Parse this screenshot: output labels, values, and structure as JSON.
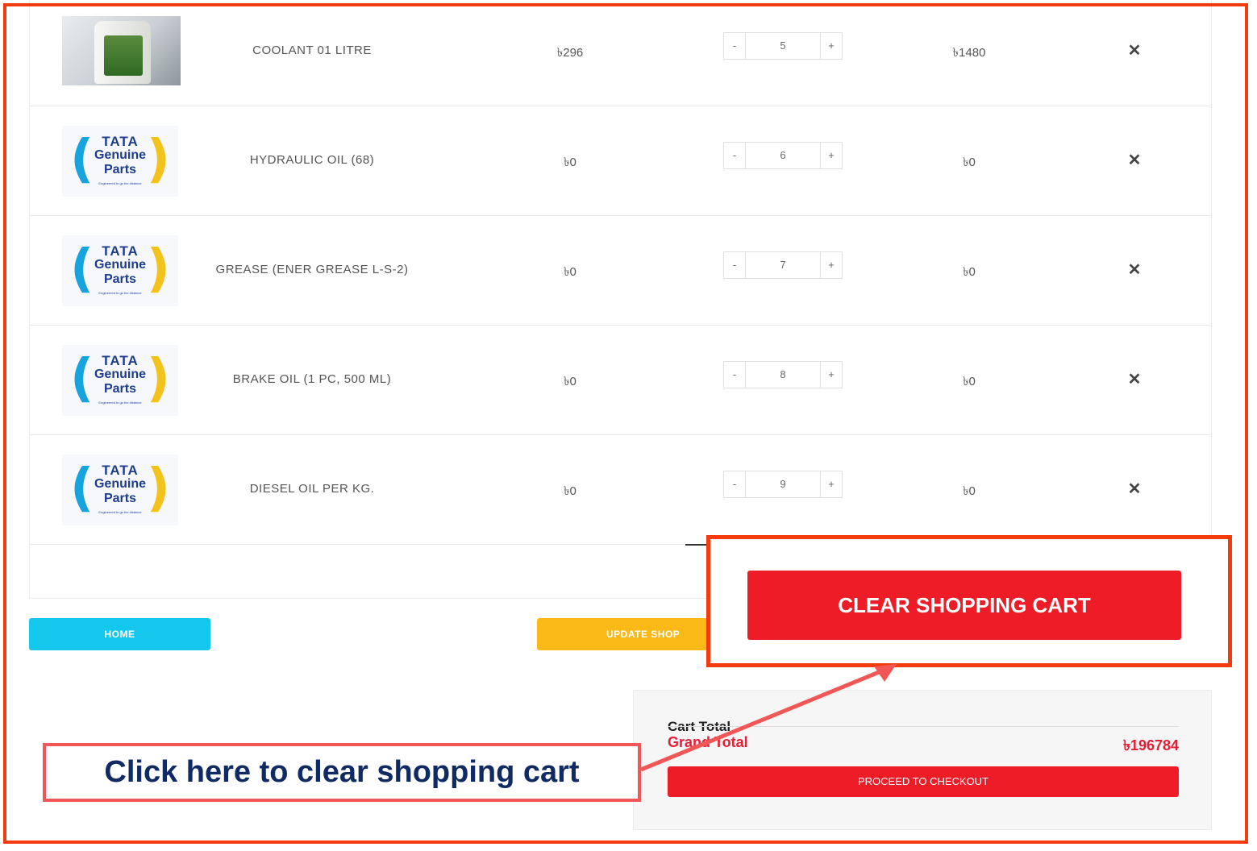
{
  "cart": {
    "items": [
      {
        "name": "COOLANT 01 LITRE",
        "price": "৳296",
        "qty": "5",
        "subtotal": "৳1480",
        "minus": "-",
        "plus": "+",
        "remove": "✕"
      },
      {
        "name": "HYDRAULIC OIL (68)",
        "price": "৳0",
        "qty": "6",
        "subtotal": "৳0",
        "minus": "-",
        "plus": "+",
        "remove": "✕"
      },
      {
        "name": "GREASE (ENER GREASE L-S-2)",
        "price": "৳0",
        "qty": "7",
        "subtotal": "৳0",
        "minus": "-",
        "plus": "+",
        "remove": "✕"
      },
      {
        "name": "BRAKE OIL (1 PC, 500 ML)",
        "price": "৳0",
        "qty": "8",
        "subtotal": "৳0",
        "minus": "-",
        "plus": "+",
        "remove": "✕"
      },
      {
        "name": "DIESEL OIL PER KG.",
        "price": "৳0",
        "qty": "9",
        "subtotal": "৳0",
        "minus": "-",
        "plus": "+",
        "remove": "✕"
      }
    ],
    "logo": {
      "line1": "TATA",
      "line2": "Genuine",
      "line3": "Parts",
      "tagline": "Engineered to go the distance"
    }
  },
  "actions": {
    "home": "HOME",
    "update": "UPDATE SHOP",
    "clear": "CLEAR SHOPPING CART"
  },
  "totals": {
    "cart_total": "Cart Total",
    "grand_total_label": "Grand Total",
    "grand_total_value": "৳196784",
    "checkout": "PROCEED TO CHECKOUT"
  },
  "annotation": {
    "callout": "Click here to clear shopping cart"
  },
  "colors": {
    "highlight": "#f43b0e",
    "danger": "#ee1c27",
    "home": "#13c8ec",
    "update": "#fbb918",
    "callout_text": "#102a63"
  }
}
